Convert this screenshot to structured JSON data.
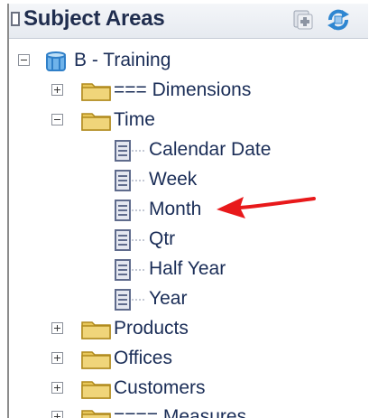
{
  "panel": {
    "title": "Subject Areas",
    "toolbar": {
      "add_icon": "add-subject-area-icon",
      "refresh_icon": "refresh-icon"
    }
  },
  "tree": {
    "root": {
      "label": "B - Training",
      "icon": "subject-area-cube-icon",
      "expanded": true
    },
    "items": [
      {
        "label": "=== Dimensions",
        "icon": "folder-icon",
        "expanded": false
      },
      {
        "label": "Time",
        "icon": "folder-icon",
        "expanded": true,
        "children": [
          {
            "label": "Calendar Date",
            "icon": "column-icon"
          },
          {
            "label": "Week",
            "icon": "column-icon"
          },
          {
            "label": "Month",
            "icon": "column-icon"
          },
          {
            "label": "Qtr",
            "icon": "column-icon"
          },
          {
            "label": "Half Year",
            "icon": "column-icon"
          },
          {
            "label": "Year",
            "icon": "column-icon"
          }
        ]
      },
      {
        "label": "Products",
        "icon": "folder-icon",
        "expanded": false
      },
      {
        "label": "Offices",
        "icon": "folder-icon",
        "expanded": false
      },
      {
        "label": "Customers",
        "icon": "folder-icon",
        "expanded": false
      },
      {
        "label": "==== Measures",
        "icon": "folder-icon",
        "expanded": false
      }
    ]
  },
  "annotation": {
    "icon": "red-arrow-icon",
    "color": "#e8191b"
  },
  "colors": {
    "folder": "#e8c75a",
    "column_icon": "#5f6b8c",
    "text": "#1a2d57"
  }
}
